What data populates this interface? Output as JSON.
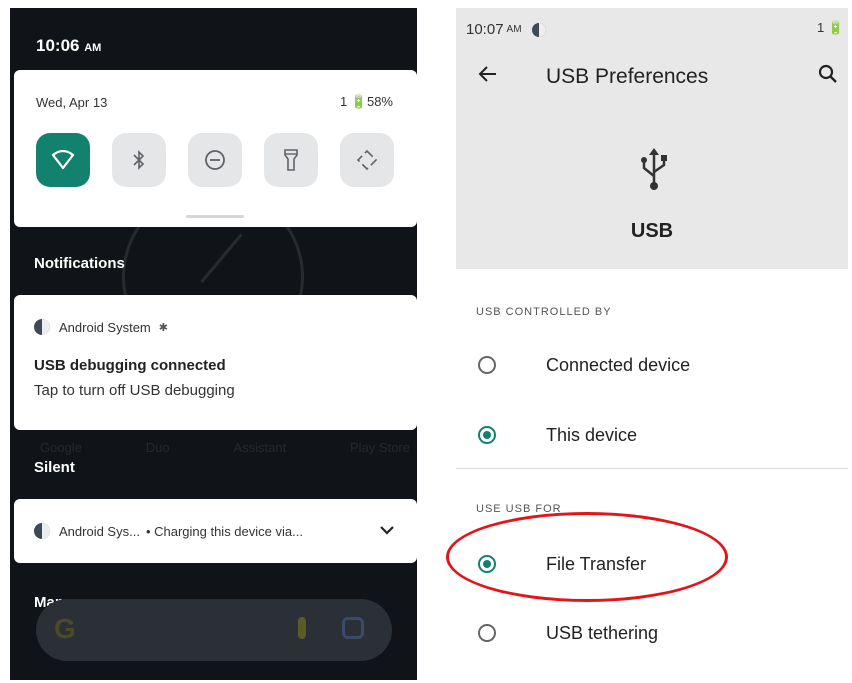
{
  "left": {
    "time": "10:06",
    "time_ampm": "AM",
    "quick_settings": {
      "date": "Wed, Apr 13",
      "battery_text": "1 🔋58%",
      "tiles": [
        {
          "name": "wifi-icon",
          "active": true
        },
        {
          "name": "bluetooth-icon",
          "active": false
        },
        {
          "name": "do-not-disturb-icon",
          "active": false
        },
        {
          "name": "flashlight-icon",
          "active": false
        },
        {
          "name": "auto-rotate-icon",
          "active": false
        }
      ]
    },
    "notifications_label": "Notifications",
    "usb_notification": {
      "app": "Android System",
      "title": "USB debugging connected",
      "text": "Tap to turn off USB debugging"
    },
    "home_labels": [
      "Google",
      "Duo",
      "Assistant",
      "Play Store"
    ],
    "silent_label": "Silent",
    "charging_notification": {
      "app": "Android Sys...",
      "text": "• Charging this device via..."
    },
    "manage_label": "Manage",
    "search_logo": "G"
  },
  "right": {
    "time": "10:07",
    "time_ampm": "AM",
    "status_right": "1 🔋",
    "title": "USB Preferences",
    "header_label": "USB",
    "controlled_by_label": "USB CONTROLLED BY",
    "controlled_by_options": [
      {
        "label": "Connected device",
        "checked": false
      },
      {
        "label": "This device",
        "checked": true
      }
    ],
    "use_for_label": "USE USB FOR",
    "use_for_options": [
      {
        "label": "File Transfer",
        "checked": true
      },
      {
        "label": "USB tethering",
        "checked": false
      }
    ]
  },
  "colors": {
    "accent": "#12826f",
    "highlight": "#e0161b"
  }
}
